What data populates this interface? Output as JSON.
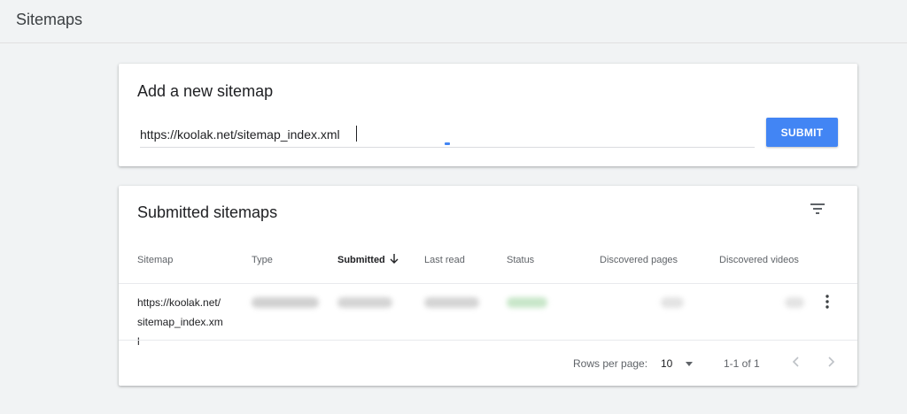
{
  "page": {
    "title": "Sitemaps"
  },
  "add_sitemap": {
    "title": "Add a new sitemap",
    "input_value": "https://koolak.net/sitemap_index.xml",
    "submit_label": "SUBMIT"
  },
  "submitted": {
    "title": "Submitted sitemaps",
    "columns": [
      "Sitemap",
      "Type",
      "Submitted",
      "Last read",
      "Status",
      "Discovered pages",
      "Discovered videos"
    ],
    "sorted_column": "Submitted",
    "rows": [
      {
        "sitemap": "https://koolak.net/sitemap_index.xml"
      }
    ],
    "footer": {
      "rows_per_page_label": "Rows per page:",
      "rows_per_page": "10",
      "range": "1-1 of 1"
    }
  },
  "colors": {
    "accent": "#4285f4",
    "background": "#f1f3f4",
    "card": "#ffffff"
  },
  "icons": [
    "filter-icon",
    "sort-arrow-down-icon",
    "more-vert-icon",
    "chevron-down-icon",
    "chevron-left-icon",
    "chevron-right-icon"
  ]
}
